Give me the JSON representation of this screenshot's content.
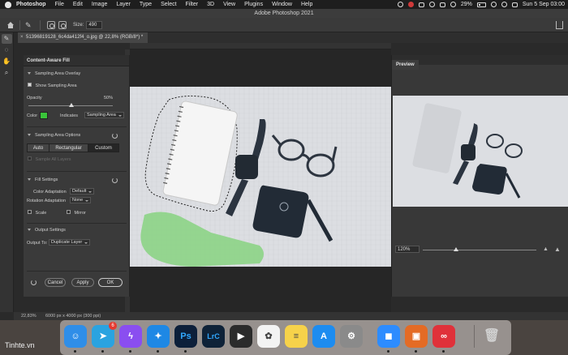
{
  "menubar": {
    "items": [
      "Photoshop",
      "File",
      "Edit",
      "Image",
      "Layer",
      "Type",
      "Select",
      "Filter",
      "3D",
      "View",
      "Plugins",
      "Window",
      "Help"
    ],
    "battery": "29%",
    "datetime": "Sun 5 Sep  03:00"
  },
  "window": {
    "title": "Adobe Photoshop 2021"
  },
  "options": {
    "size_label": "Size:",
    "size_value": "490"
  },
  "document": {
    "tab_title": "51396819128_6c4da412f4_o.jpg @ 22,8% (RGB/8*) *",
    "close": "×"
  },
  "toolbar": {
    "icons": [
      "brush-icon",
      "lasso-icon",
      "hand-icon",
      "zoom-icon"
    ]
  },
  "caf": {
    "panel_title": "Content-Aware Fill",
    "sampling_overlay": {
      "title": "Sampling Area Overlay",
      "show_label": "Show Sampling Area",
      "opacity_label": "Opacity",
      "opacity_value": "50%",
      "opacity_fraction": 0.5,
      "color_label": "Color",
      "color": "#3ac43a",
      "indicates_label": "Indicates",
      "indicates_value": "Sampling Area"
    },
    "sampling_options": {
      "title": "Sampling Area Options",
      "modes": [
        "Auto",
        "Rectangular",
        "Custom"
      ],
      "selected": "Custom",
      "sample_all_layers": "Sample All Layers"
    },
    "fill_settings": {
      "title": "Fill Settings",
      "color_adaptation_label": "Color Adaptation",
      "color_adaptation_value": "Default",
      "rotation_adaptation_label": "Rotation Adaptation",
      "rotation_adaptation_value": "None",
      "scale_label": "Scale",
      "mirror_label": "Mirror"
    },
    "output_settings": {
      "title": "Output Settings",
      "output_to_label": "Output To:",
      "output_to_value": "Duplicate Layer"
    },
    "buttons": {
      "cancel": "Cancel",
      "apply": "Apply",
      "ok": "OK"
    }
  },
  "preview": {
    "tab_label": "Preview",
    "zoom_value": "120%"
  },
  "statusbar": {
    "zoom": "22,83%",
    "info": "6000 px x 4000 px (300 ppi)"
  },
  "dock": {
    "apps": [
      {
        "name": "finder",
        "glyph": "☺",
        "color": "#2f8ee8"
      },
      {
        "name": "telegram",
        "glyph": "➤",
        "color": "#2aa3e0",
        "badge": "6"
      },
      {
        "name": "messenger",
        "glyph": "ϟ",
        "color": "#8a4ef0"
      },
      {
        "name": "safari",
        "glyph": "✦",
        "color": "#1e88e5"
      },
      {
        "name": "photoshop",
        "glyph": "Ps",
        "color": "#0c1f3a"
      },
      {
        "name": "lightroom-classic",
        "glyph": "LrC",
        "color": "#0e2238"
      },
      {
        "name": "final-cut-pro",
        "glyph": "▶",
        "color": "#2b2b2b"
      },
      {
        "name": "photos",
        "glyph": "✿",
        "color": "#f3f3f3"
      },
      {
        "name": "notes",
        "glyph": "≡",
        "color": "#f6d24a"
      },
      {
        "name": "app-store",
        "glyph": "A",
        "color": "#1d8cf0"
      },
      {
        "name": "system-preferences",
        "glyph": "⚙",
        "color": "#8a8a8a"
      },
      {
        "name": "zoom",
        "glyph": "◼",
        "color": "#2d8cff"
      },
      {
        "name": "presenter",
        "glyph": "▣",
        "color": "#e46b25"
      },
      {
        "name": "creative-cloud",
        "glyph": "∞",
        "color": "#e0313a"
      }
    ],
    "trash": {
      "name": "trash",
      "glyph": "🗑",
      "color": "#9a9a9a"
    }
  },
  "watermark": "Tinhte.vn"
}
